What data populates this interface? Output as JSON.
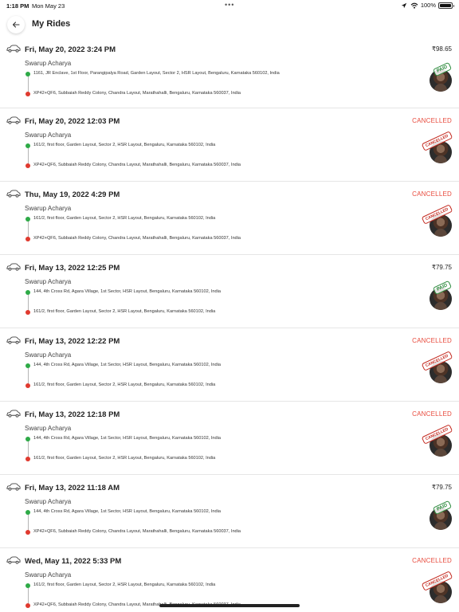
{
  "status_bar": {
    "time": "1:18 PM",
    "date": "Mon May 23",
    "dots": "•••",
    "battery": "100%"
  },
  "header": {
    "back_icon": "arrow-left-icon",
    "title": "My Rides"
  },
  "colors": {
    "cancelled": "#e84a3c",
    "pickup_dot": "#2eaa47",
    "drop_dot": "#e03a2f"
  },
  "rides": [
    {
      "date": "Fri, May 20, 2022 3:24 PM",
      "driver": "Swarup Acharya",
      "status": "₹98.65",
      "is_cancelled": false,
      "stamp": "PAID",
      "pickup": "1161, JR Enclave, 1st Floor, Parangipalya Road, Garden Layout, Sector 2, HSR Layout, Bengaluru, Karnataka 560102, India",
      "drop": "XP42+QF6, Subbaiah Reddy Colony, Chandra Layout, Marathahalli, Bengaluru, Karnataka 560037, India"
    },
    {
      "date": "Fri, May 20, 2022 12:03 PM",
      "driver": "Swarup Acharya",
      "status": "CANCELLED",
      "is_cancelled": true,
      "stamp": "CANCELLED",
      "pickup": "161/2, first floor, Garden Layout, Sector 2, HSR Layout, Bengaluru, Karnataka 560102, India",
      "drop": "XP42+QF6, Subbaiah Reddy Colony, Chandra Layout, Marathahalli, Bengaluru, Karnataka 560037, India"
    },
    {
      "date": "Thu, May 19, 2022 4:29 PM",
      "driver": "Swarup Acharya",
      "status": "CANCELLED",
      "is_cancelled": true,
      "stamp": "CANCELLED",
      "pickup": "161/2, first floor, Garden Layout, Sector 2, HSR Layout, Bengaluru, Karnataka 560102, India",
      "drop": "XP42+QF6, Subbaiah Reddy Colony, Chandra Layout, Marathahalli, Bengaluru, Karnataka 560037, India"
    },
    {
      "date": "Fri, May 13, 2022 12:25 PM",
      "driver": "Swarup Acharya",
      "status": "₹79.75",
      "is_cancelled": false,
      "stamp": "PAID",
      "pickup": "144, 4th Cross Rd, Agara Village, 1st Sector, HSR Layout, Bengaluru, Karnataka 560102, India",
      "drop": "161/2, first floor, Garden Layout, Sector 2, HSR Layout, Bengaluru, Karnataka 560102, India"
    },
    {
      "date": "Fri, May 13, 2022 12:22 PM",
      "driver": "Swarup Acharya",
      "status": "CANCELLED",
      "is_cancelled": true,
      "stamp": "CANCELLED",
      "pickup": "144, 4th Cross Rd, Agara Village, 1st Sector, HSR Layout, Bengaluru, Karnataka 560102, India",
      "drop": "161/2, first floor, Garden Layout, Sector 2, HSR Layout, Bengaluru, Karnataka 560102, India"
    },
    {
      "date": "Fri, May 13, 2022 12:18 PM",
      "driver": "Swarup Acharya",
      "status": "CANCELLED",
      "is_cancelled": true,
      "stamp": "CANCELLED",
      "pickup": "144, 4th Cross Rd, Agara Village, 1st Sector, HSR Layout, Bengaluru, Karnataka 560102, India",
      "drop": "161/2, first floor, Garden Layout, Sector 2, HSR Layout, Bengaluru, Karnataka 560102, India"
    },
    {
      "date": "Fri, May 13, 2022 11:18 AM",
      "driver": "Swarup Acharya",
      "status": "₹79.75",
      "is_cancelled": false,
      "stamp": "PAID",
      "pickup": "144, 4th Cross Rd, Agara Village, 1st Sector, HSR Layout, Bengaluru, Karnataka 560102, India",
      "drop": "XP42+QF6, Subbaiah Reddy Colony, Chandra Layout, Marathahalli, Bengaluru, Karnataka 560037, India"
    },
    {
      "date": "Wed, May 11, 2022 5:33 PM",
      "driver": "Swarup Acharya",
      "status": "CANCELLED",
      "is_cancelled": true,
      "stamp": "CANCELLED",
      "pickup": "161/2, first floor, Garden Layout, Sector 2, HSR Layout, Bengaluru, Karnataka 560102, India",
      "drop": "XP42+QF6, Subbaiah Reddy Colony, Chandra Layout, Marathahalli, Bengaluru, Karnataka 560037, India"
    }
  ]
}
